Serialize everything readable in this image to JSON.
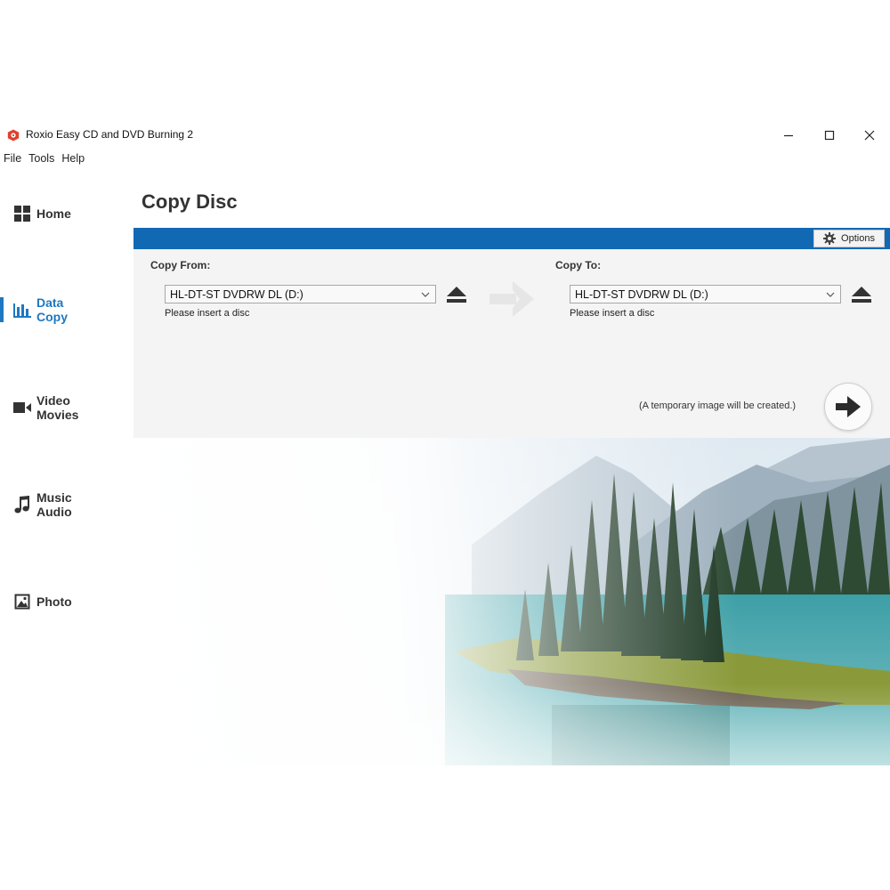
{
  "window": {
    "title": "Roxio Easy CD and DVD Burning 2",
    "controls": {
      "minimize_icon": "minimize-icon",
      "maximize_icon": "maximize-icon",
      "close_icon": "close-icon"
    }
  },
  "menu": [
    "File",
    "Tools",
    "Help"
  ],
  "sidebar": {
    "items": [
      {
        "line1": "Home",
        "line2": "",
        "icon": "grid-icon",
        "active": false
      },
      {
        "line1": "Data",
        "line2": "Copy",
        "icon": "bar-chart-icon",
        "active": true
      },
      {
        "line1": "Video",
        "line2": "Movies",
        "icon": "video-camera-icon",
        "active": false
      },
      {
        "line1": "Music",
        "line2": "Audio",
        "icon": "music-note-icon",
        "active": false
      },
      {
        "line1": "Photo",
        "line2": "",
        "icon": "image-icon",
        "active": false
      }
    ]
  },
  "main": {
    "title": "Copy Disc",
    "options_label": "Options",
    "copy_from": {
      "label": "Copy From:",
      "drive": "HL-DT-ST DVDRW DL (D:)",
      "status": "Please insert a disc"
    },
    "copy_to": {
      "label": "Copy To:",
      "drive": "HL-DT-ST DVDRW DL (D:)",
      "status": "Please insert a disc"
    },
    "temp_note": "(A temporary image will be created.)"
  },
  "colors": {
    "accent": "#1269b3",
    "active_nav": "#1d78c1",
    "panel_bg": "#f4f4f4"
  }
}
